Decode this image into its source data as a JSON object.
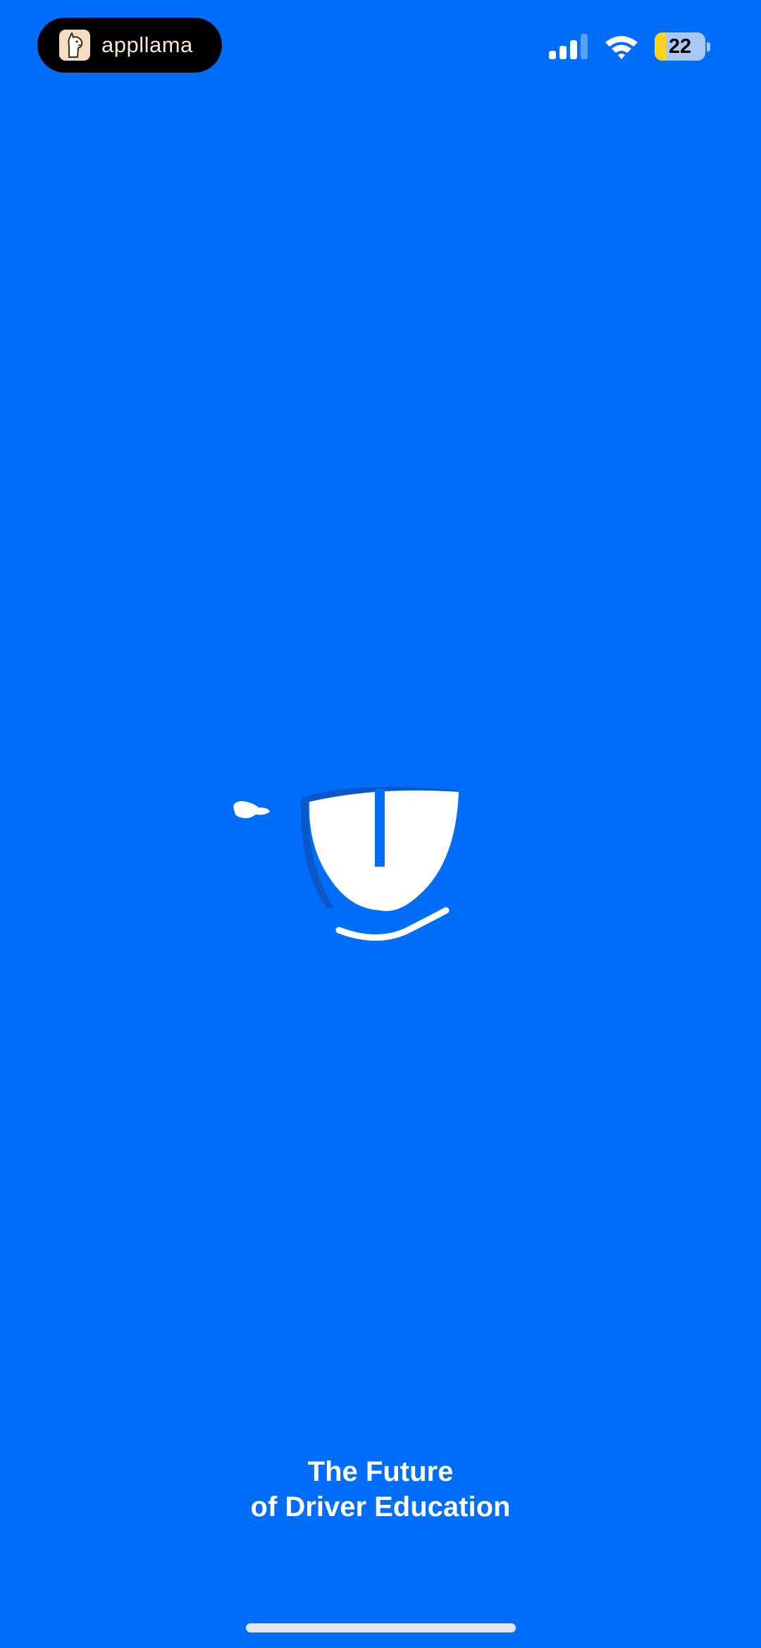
{
  "status_bar": {
    "pill_label": "appllama",
    "battery_level": "22",
    "battery_fraction": 0.22,
    "signal_bars_active": 3,
    "signal_bars_total": 4
  },
  "splash": {
    "logo_icon": "smiling-shield-mascot-icon",
    "tagline_line1": "The Future",
    "tagline_line2": "of Driver Education"
  },
  "colors": {
    "background": "#006dfb",
    "foreground": "#ffffff",
    "battery_fill": "#ffd21f"
  }
}
